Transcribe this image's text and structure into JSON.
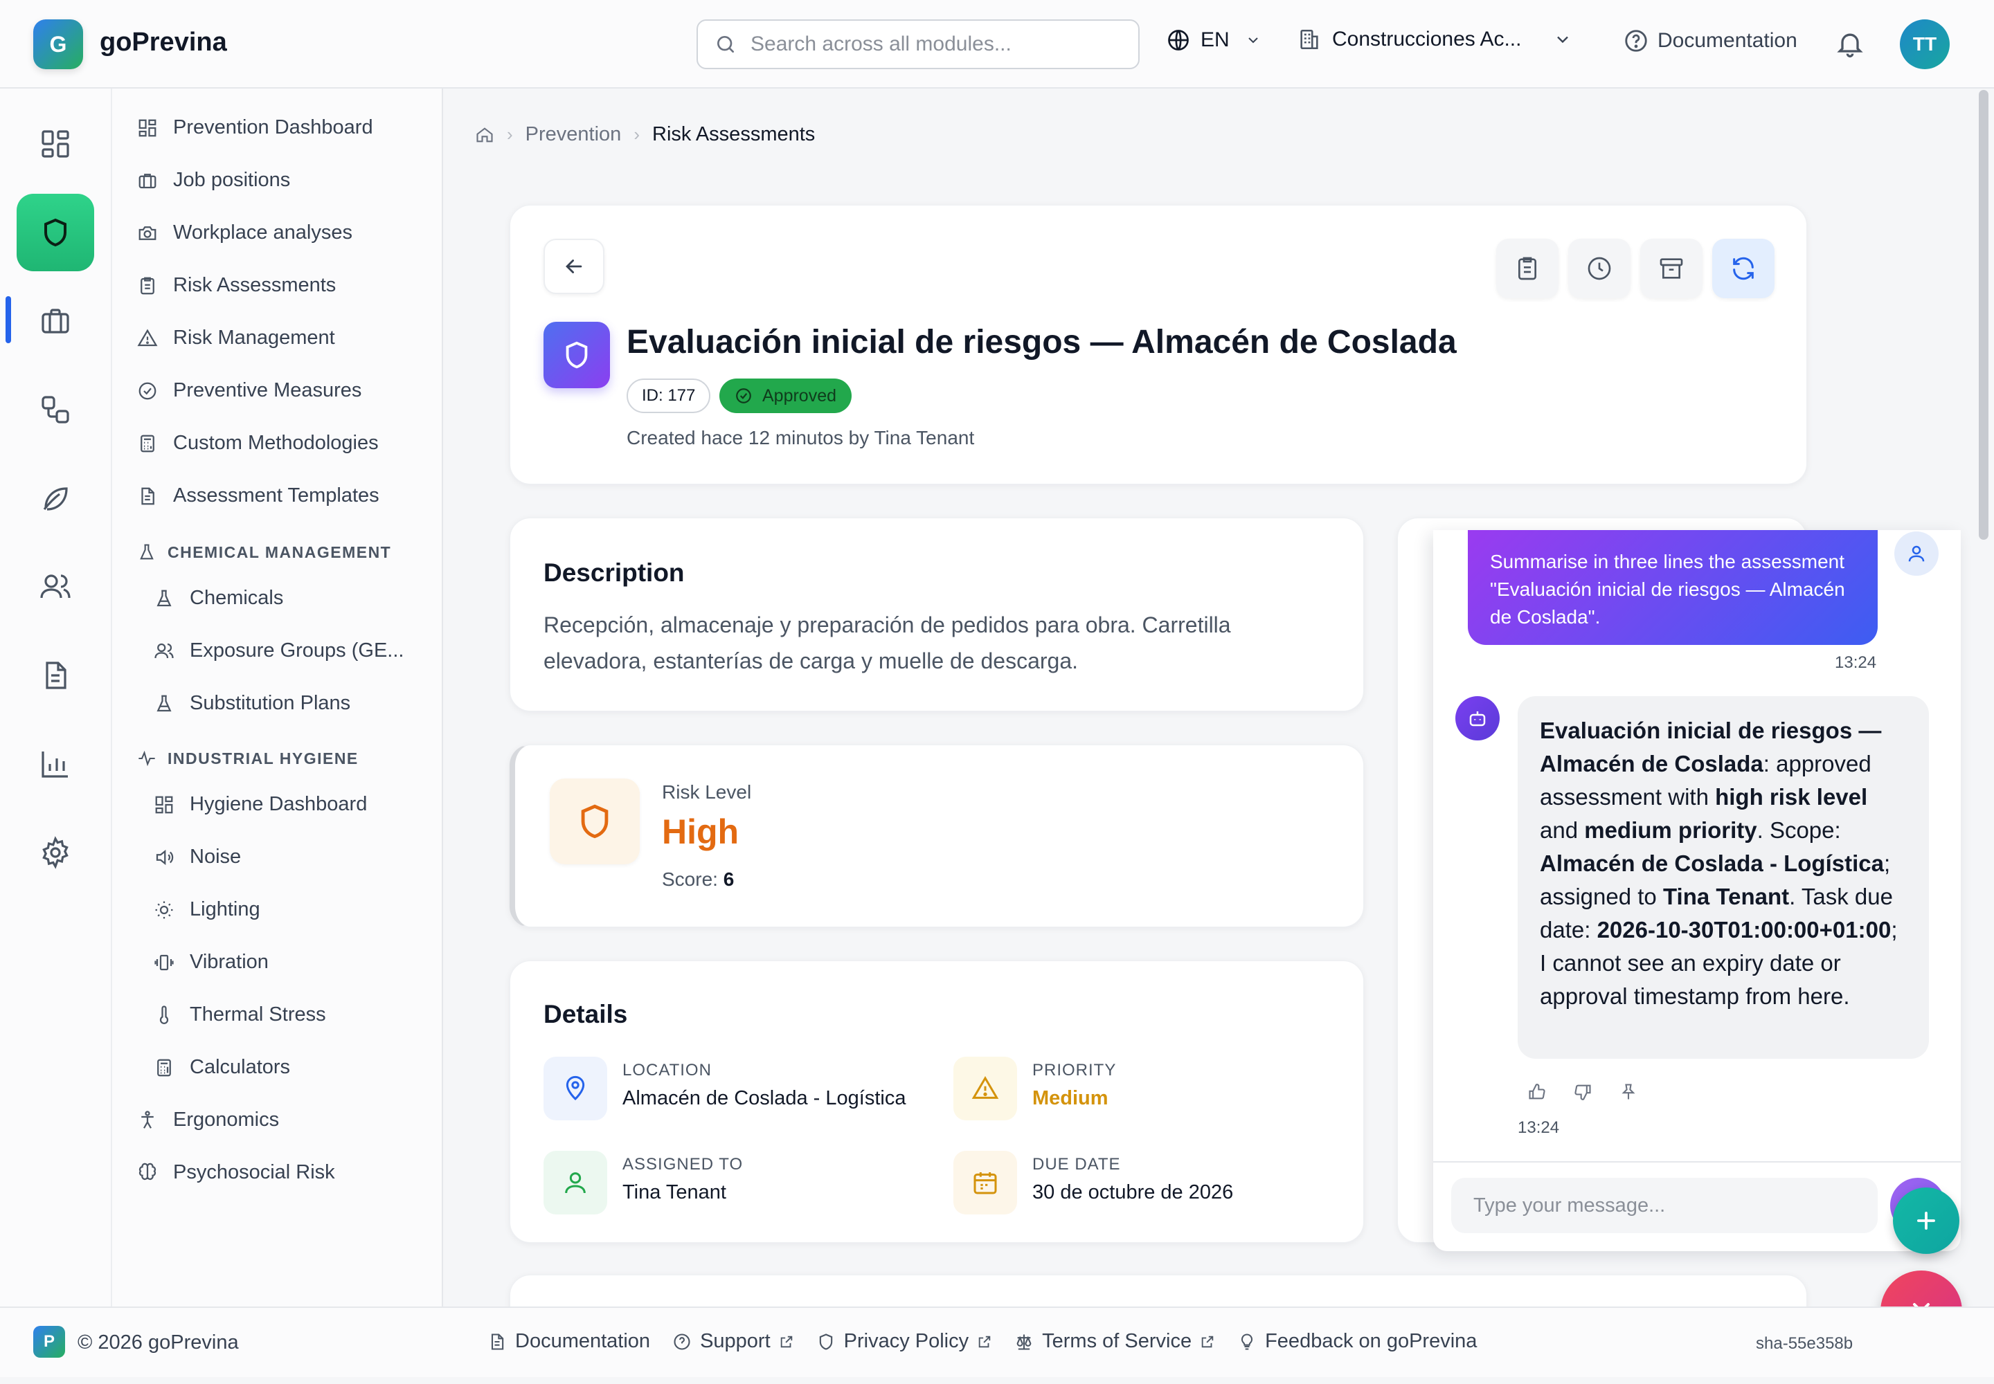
{
  "app": {
    "name": "goPrevina",
    "logo_letter": "G"
  },
  "header": {
    "search_placeholder": "Search across all modules...",
    "language": "EN",
    "organization": "Construcciones Ac...",
    "documentation": "Documentation",
    "user_initials": "TT"
  },
  "rail": {
    "items": [
      "dashboard-icon",
      "shield-icon",
      "briefcase-icon",
      "workflow-icon",
      "leaf-icon",
      "users-icon",
      "document-icon",
      "bar-chart-icon",
      "gear-icon"
    ],
    "active_index": 1,
    "active_color": "#22c47d"
  },
  "sidebar": {
    "items": [
      {
        "label": "Prevention Dashboard",
        "icon": "grid-icon"
      },
      {
        "label": "Job positions",
        "icon": "briefcase-icon"
      },
      {
        "label": "Workplace analyses",
        "icon": "camera-icon"
      },
      {
        "label": "Risk Assessments",
        "icon": "clipboard-icon"
      },
      {
        "label": "Risk Management",
        "icon": "warning-icon"
      },
      {
        "label": "Preventive Measures",
        "icon": "check-circle-icon"
      },
      {
        "label": "Custom Methodologies",
        "icon": "calculator-icon"
      },
      {
        "label": "Assessment Templates",
        "icon": "file-icon"
      }
    ],
    "chemical_section": "CHEMICAL MANAGEMENT",
    "chemical_items": [
      {
        "label": "Chemicals",
        "icon": "flask-icon"
      },
      {
        "label": "Exposure Groups (GE...",
        "icon": "users-icon"
      },
      {
        "label": "Substitution Plans",
        "icon": "flask-icon"
      }
    ],
    "hygiene_section": "INDUSTRIAL HYGIENE",
    "hygiene_items": [
      {
        "label": "Hygiene Dashboard",
        "icon": "grid-icon"
      },
      {
        "label": "Noise",
        "icon": "speaker-icon"
      },
      {
        "label": "Lighting",
        "icon": "sun-icon"
      },
      {
        "label": "Vibration",
        "icon": "vibration-icon"
      },
      {
        "label": "Thermal Stress",
        "icon": "thermometer-icon"
      },
      {
        "label": "Calculators",
        "icon": "calculator-icon"
      }
    ],
    "bottom_items": [
      {
        "label": "Ergonomics",
        "icon": "person-icon"
      },
      {
        "label": "Psychosocial Risk",
        "icon": "brain-icon"
      }
    ]
  },
  "breadcrumb": {
    "parent": "Prevention",
    "current": "Risk Assessments"
  },
  "assessment": {
    "title": "Evaluación inicial de riesgos — Almacén de Coslada",
    "id_label": "ID: 177",
    "status": "Approved",
    "status_color": "#22a84c",
    "created": "Created hace 12 minutos by Tina Tenant"
  },
  "description": {
    "heading": "Description",
    "text": "Recepción, almacenaje y preparación de pedidos para obra. Carretilla elevadora, estanterías de carga y muelle de descarga."
  },
  "risk": {
    "label": "Risk Level",
    "value": "High",
    "score_label": "Score:",
    "score": "6",
    "color": "#e36a11"
  },
  "details": {
    "heading": "Details",
    "location_label": "LOCATION",
    "location": "Almacén de Coslada - Logística",
    "priority_label": "PRIORITY",
    "priority": "Medium",
    "assigned_label": "ASSIGNED TO",
    "assigned": "Tina Tenant",
    "due_label": "DUE DATE",
    "due": "30 de octubre de 2026"
  },
  "chat": {
    "user_message": "Summarise in three lines the assessment \"Evaluación inicial de riesgos — Almacén de Coslada\".",
    "user_time": "13:24",
    "bot_parts": {
      "b1": "Evaluación inicial de riesgos — Almacén de Coslada",
      "t1": ": approved assessment with ",
      "b2": "high risk level",
      "t2": " and ",
      "b3": "medium priority",
      "t3": ". Scope: ",
      "b4": "Almacén de Coslada - Logística",
      "t4": "; assigned to ",
      "b5": "Tina Tenant",
      "t5": ". Task due date: ",
      "b6": "2026-10-30T01:00:00+01:00",
      "t6": "; I cannot see an expiry date or approval timestamp from here."
    },
    "bot_time": "13:24",
    "input_placeholder": "Type your message..."
  },
  "footer": {
    "logo_letter": "P",
    "copyright": "© 2026 goPrevina",
    "links": [
      "Documentation",
      "Support",
      "Privacy Policy",
      "Terms of Service",
      "Feedback on goPrevina"
    ],
    "version": "sha-55e358b"
  }
}
